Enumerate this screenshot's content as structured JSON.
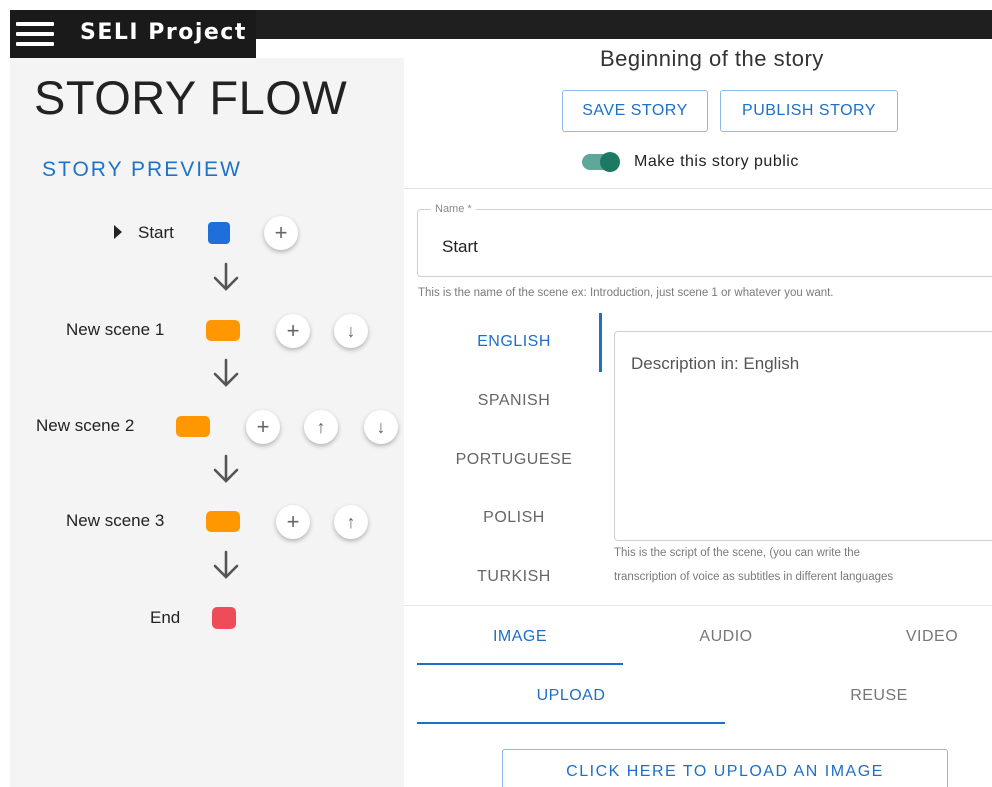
{
  "app": {
    "title": "SELI Project",
    "menu_icon": "hamburger-menu-icon"
  },
  "left": {
    "page_title": "STORY FLOW",
    "preview_title": "STORY PREVIEW",
    "nodes": [
      {
        "label": "Start",
        "color": "#1e6fd9",
        "buttons": [
          "plus-icon"
        ]
      },
      {
        "label": "New scene 1",
        "color": "#ff9800",
        "buttons": [
          "plus-icon",
          "arrow-down-icon"
        ]
      },
      {
        "label": "New scene 2",
        "color": "#ff9800",
        "buttons": [
          "plus-icon",
          "arrow-up-icon",
          "arrow-down-icon"
        ]
      },
      {
        "label": "New scene 3",
        "color": "#ff9800",
        "buttons": [
          "plus-icon",
          "arrow-up-icon"
        ]
      },
      {
        "label": "End",
        "color": "#ef4c5a",
        "buttons": []
      }
    ],
    "plus_glyph": "+",
    "up_glyph": "↑",
    "down_glyph": "↓"
  },
  "right": {
    "heading": "Beginning of the story",
    "save_label": "SAVE STORY",
    "publish_label": "PUBLISH STORY",
    "public_toggle_label": "Make this story public",
    "public_toggle_on": true,
    "name_field": {
      "legend": "Name *",
      "value": "Start",
      "helper": "This is the name of the scene ex: Introduction, just scene 1 or whatever you want."
    },
    "languages": [
      "ENGLISH",
      "SPANISH",
      "PORTUGUESE",
      "POLISH",
      "TURKISH"
    ],
    "active_language": "ENGLISH",
    "description": {
      "placeholder": "Description in: English",
      "helper_line1": "This is the script of the scene, (you can write the",
      "helper_line2": "transcription of voice as subtitles in different languages"
    },
    "media_tabs": [
      "IMAGE",
      "AUDIO",
      "VIDEO"
    ],
    "active_media_tab": "IMAGE",
    "source_tabs": [
      "UPLOAD",
      "REUSE"
    ],
    "active_source_tab": "UPLOAD",
    "upload_label": "CLICK HERE TO UPLOAD AN IMAGE"
  },
  "colors": {
    "accent": "#1e6fc8",
    "toggle_on": "#1c7a63",
    "topbar": "#1f1f1f"
  }
}
